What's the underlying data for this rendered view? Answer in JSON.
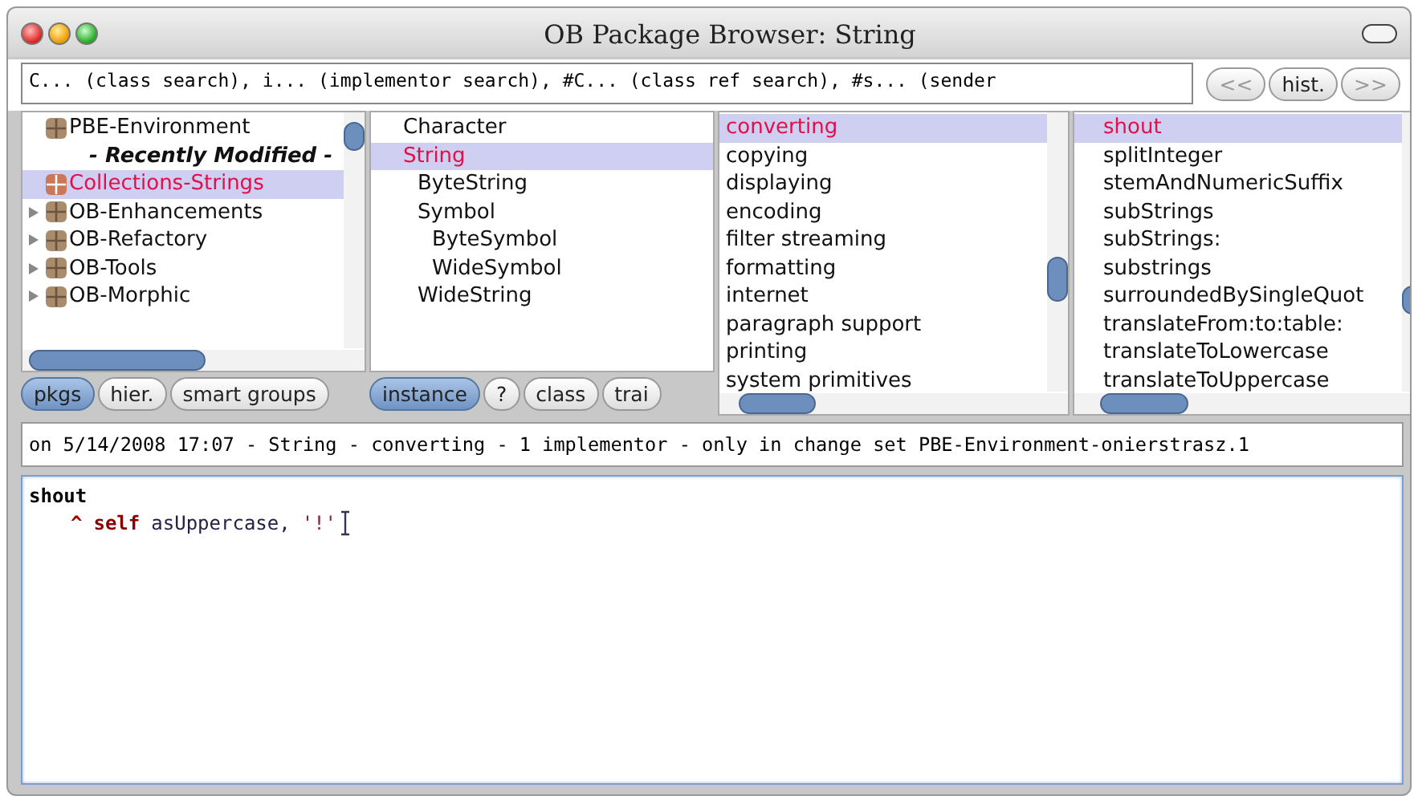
{
  "window": {
    "title": "OB Package Browser: String"
  },
  "search": {
    "value": "C... (class search), i... (implementor search), #C... (class ref search), #s... (sender"
  },
  "history_buttons": [
    "<<",
    "hist.",
    ">>"
  ],
  "packages": [
    {
      "kind": "package",
      "label": "PBE-Environment",
      "expandable": false,
      "selected": false
    },
    {
      "kind": "header",
      "label": "- Recently Modified -"
    },
    {
      "kind": "package",
      "label": "Collections-Strings",
      "expandable": false,
      "selected": true
    },
    {
      "kind": "package",
      "label": "OB-Enhancements",
      "expandable": true,
      "selected": false
    },
    {
      "kind": "package",
      "label": "OB-Refactory",
      "expandable": true,
      "selected": false
    },
    {
      "kind": "package",
      "label": "OB-Tools",
      "expandable": true,
      "selected": false
    },
    {
      "kind": "package",
      "label": "OB-Morphic",
      "expandable": true,
      "selected": false
    }
  ],
  "classes": [
    {
      "label": "Character",
      "selected": false
    },
    {
      "label": "String",
      "selected": true,
      "children": [
        {
          "label": "ByteString",
          "selected": false
        },
        {
          "label": "Symbol",
          "selected": false,
          "children": [
            {
              "label": "ByteSymbol",
              "selected": false
            },
            {
              "label": "WideSymbol",
              "selected": false
            }
          ]
        },
        {
          "label": "WideString",
          "selected": false
        }
      ]
    }
  ],
  "protocols": [
    {
      "label": "converting",
      "selected": true
    },
    {
      "label": "copying",
      "selected": false
    },
    {
      "label": "displaying",
      "selected": false
    },
    {
      "label": "encoding",
      "selected": false
    },
    {
      "label": "filter streaming",
      "selected": false
    },
    {
      "label": "formatting",
      "selected": false
    },
    {
      "label": "internet",
      "selected": false
    },
    {
      "label": "paragraph support",
      "selected": false
    },
    {
      "label": "printing",
      "selected": false
    },
    {
      "label": "system primitives",
      "selected": false
    }
  ],
  "methods": [
    {
      "label": "shout",
      "selected": true
    },
    {
      "label": "splitInteger",
      "selected": false
    },
    {
      "label": "stemAndNumericSuffix",
      "selected": false
    },
    {
      "label": "subStrings",
      "selected": false
    },
    {
      "label": "subStrings:",
      "selected": false
    },
    {
      "label": "substrings",
      "selected": false
    },
    {
      "label": "surroundedBySingleQuot",
      "selected": false
    },
    {
      "label": "translateFrom:to:table:",
      "selected": false
    },
    {
      "label": "translateToLowercase",
      "selected": false
    },
    {
      "label": "translateToUppercase",
      "selected": false
    }
  ],
  "package_buttons": [
    {
      "label": "pkgs",
      "selected": true
    },
    {
      "label": "hier.",
      "selected": false
    },
    {
      "label": "smart groups",
      "selected": false
    }
  ],
  "class_buttons": [
    {
      "label": "instance",
      "selected": true
    },
    {
      "label": "?",
      "selected": false
    },
    {
      "label": "class",
      "selected": false
    },
    {
      "label": "trai",
      "selected": false
    }
  ],
  "info": "on 5/14/2008 17:07 - String - converting - 1 implementor - only in change set PBE-Environment-onierstrasz.1",
  "code": [
    [
      {
        "kind": "selector",
        "text": "shout"
      }
    ],
    [
      {
        "kind": "caret",
        "text": "^"
      },
      {
        "kind": "keyword",
        "text": "self"
      },
      {
        "kind": "message",
        "text": "asUppercase,"
      },
      {
        "kind": "string",
        "text": "'!'"
      }
    ]
  ]
}
